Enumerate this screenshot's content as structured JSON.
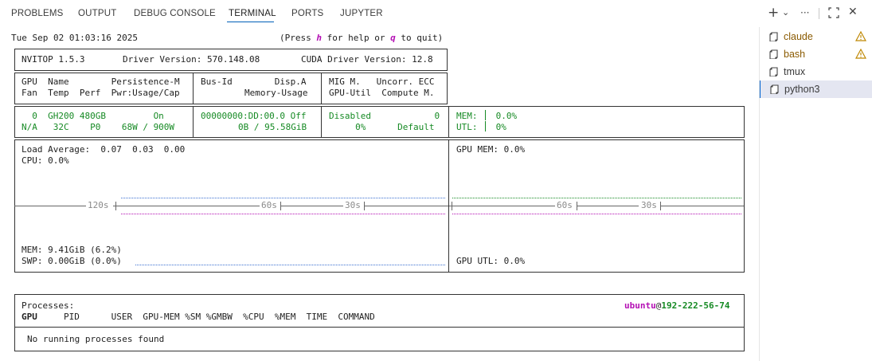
{
  "tabs": [
    {
      "label": "PROBLEMS"
    },
    {
      "label": "OUTPUT"
    },
    {
      "label": "DEBUG CONSOLE"
    },
    {
      "label": "TERMINAL",
      "active": true
    },
    {
      "label": "PORTS"
    },
    {
      "label": "JUPYTER"
    }
  ],
  "actions": {
    "new": "+",
    "dropdown": "⌄",
    "more": "···",
    "maximize": "⛶",
    "close": "✕"
  },
  "terminal": {
    "timestamp": "Tue Sep 02 01:03:16 2025",
    "help_pre": "(Press ",
    "help_key_h": "h",
    "help_mid": " for help or ",
    "help_key_q": "q",
    "help_post": " to quit)",
    "header": {
      "nvitop": "NVITOP 1.5.3",
      "driver": "Driver Version: 570.148.08",
      "cuda": "CUDA Driver Version: 12.8"
    },
    "columns": {
      "c1r1": "GPU  Name        Persistence-M",
      "c1r2": "Fan  Temp  Perf  Pwr:Usage/Cap",
      "c2r1": "Bus-Id        Disp.A",
      "c2r2": "Memory-Usage",
      "c3r1": "MIG M.   Uncorr. ECC",
      "c3r2": "GPU-Util  Compute M."
    },
    "gpu": {
      "c1r1": "  0  GH200 480GB         On",
      "c1r2": "N/A   32C    P0    68W / 900W",
      "c2r1": "00000000:DD:00.0 Off",
      "c2r2": "0B / 95.58GiB",
      "c3r1": "Disabled            0",
      "c3r2": "     0%      Default",
      "mem_label": "MEM:",
      "mem_value": " 0.0%",
      "utl_label": "UTL:",
      "utl_value": " 0%"
    },
    "host": {
      "load": "Load Average:  0.07  0.03  0.00",
      "cpu": "CPU: 0.0%",
      "mem": "MEM: 9.41GiB (6.2%)",
      "swp": "SWP: 0.00GiB (0.0%)",
      "gpu_mem": "GPU MEM: 0.0%",
      "gpu_utl": "GPU UTL: 0.0%",
      "axis_left": [
        "120s",
        "60s",
        "30s"
      ],
      "axis_right": [
        "60s",
        "30s"
      ]
    },
    "processes": {
      "title": "Processes:",
      "user": "ubuntu",
      "at": "@",
      "hostname": "192-222-56-74",
      "col_gpu": "GPU",
      "col_rest": "     PID      USER  GPU-MEM %SM %GMBW  %CPU  %MEM  TIME  COMMAND",
      "empty": "No running processes found"
    }
  },
  "sidebar": {
    "items": [
      {
        "label": "claude",
        "warning": true
      },
      {
        "label": "bash",
        "warning": true
      },
      {
        "label": "tmux",
        "warning": false
      },
      {
        "label": "python3",
        "warning": false,
        "selected": true
      }
    ]
  },
  "colors": {
    "green": "#168a24",
    "magenta": "#b40fb4",
    "accent": "#005fb8"
  }
}
